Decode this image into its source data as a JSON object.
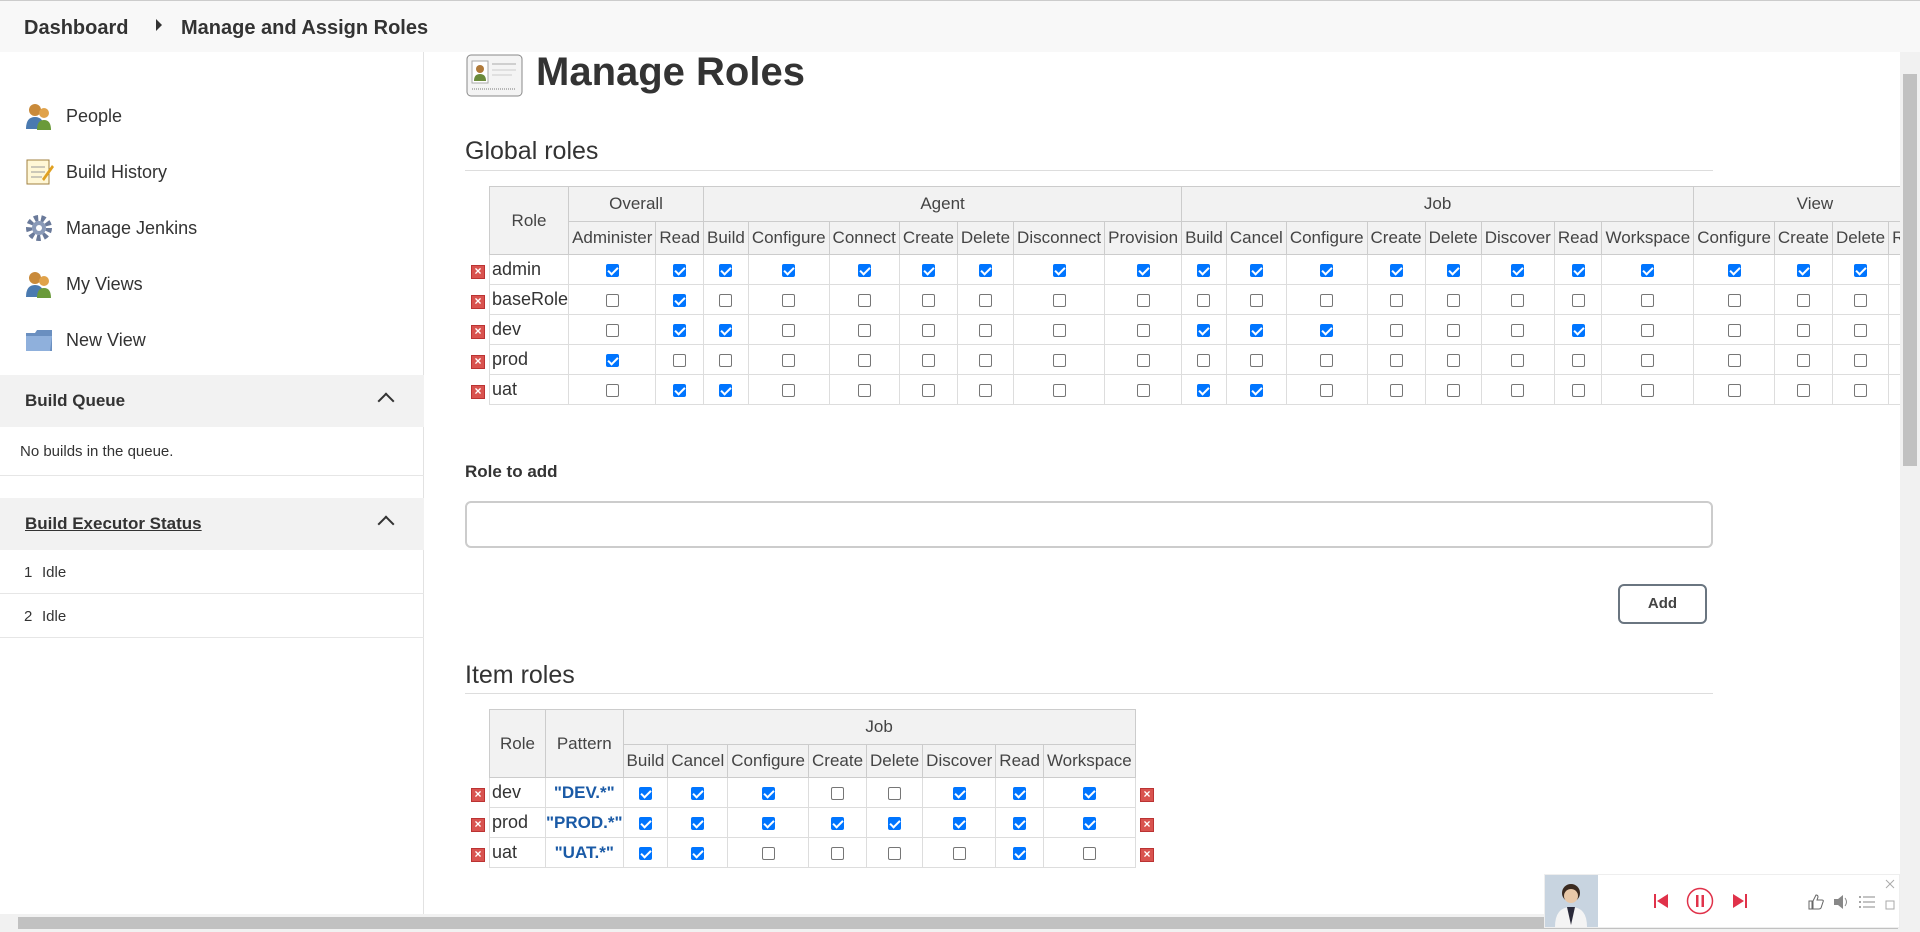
{
  "breadcrumb": {
    "dashboard": "Dashboard",
    "current": "Manage and Assign Roles"
  },
  "sidebar": {
    "items": [
      {
        "label": "People",
        "icon": "people-icon"
      },
      {
        "label": "Build History",
        "icon": "notepad-icon"
      },
      {
        "label": "Manage Jenkins",
        "icon": "gear-icon"
      },
      {
        "label": "My Views",
        "icon": "people-icon"
      },
      {
        "label": "New View",
        "icon": "folder-icon"
      }
    ]
  },
  "build_queue": {
    "title": "Build Queue",
    "empty": "No builds in the queue."
  },
  "executors": {
    "title": "Build Executor Status",
    "rows": [
      {
        "num": "1",
        "status": "Idle"
      },
      {
        "num": "2",
        "status": "Idle"
      }
    ]
  },
  "page_title": "Manage Roles",
  "global": {
    "title": "Global roles",
    "role_header": "Role",
    "groups": [
      {
        "name": "Overall",
        "perms": [
          "Administer",
          "Read"
        ]
      },
      {
        "name": "Agent",
        "perms": [
          "Build",
          "Configure",
          "Connect",
          "Create",
          "Delete",
          "Disconnect",
          "Provision"
        ]
      },
      {
        "name": "Job",
        "perms": [
          "Build",
          "Cancel",
          "Configure",
          "Create",
          "Delete",
          "Discover",
          "Read",
          "Workspace"
        ]
      },
      {
        "name": "View",
        "perms": [
          "Configure",
          "Create",
          "Delete",
          "Read"
        ]
      }
    ],
    "rows": [
      {
        "role": "admin",
        "checks": [
          1,
          1,
          1,
          1,
          1,
          1,
          1,
          1,
          1,
          1,
          1,
          1,
          1,
          1,
          1,
          1,
          1,
          1,
          1,
          1,
          1
        ]
      },
      {
        "role": "baseRole",
        "checks": [
          0,
          1,
          0,
          0,
          0,
          0,
          0,
          0,
          0,
          0,
          0,
          0,
          0,
          0,
          0,
          0,
          0,
          0,
          0,
          0,
          0
        ]
      },
      {
        "role": "dev",
        "checks": [
          0,
          1,
          1,
          0,
          0,
          0,
          0,
          0,
          0,
          1,
          1,
          1,
          0,
          0,
          0,
          1,
          0,
          0,
          0,
          0,
          0
        ]
      },
      {
        "role": "prod",
        "checks": [
          1,
          0,
          0,
          0,
          0,
          0,
          0,
          0,
          0,
          0,
          0,
          0,
          0,
          0,
          0,
          0,
          0,
          0,
          0,
          0,
          0
        ]
      },
      {
        "role": "uat",
        "checks": [
          0,
          1,
          1,
          0,
          0,
          0,
          0,
          0,
          0,
          1,
          1,
          0,
          0,
          0,
          0,
          0,
          0,
          0,
          0,
          0,
          0
        ]
      }
    ]
  },
  "role_to_add": {
    "label": "Role to add",
    "value": "",
    "button": "Add"
  },
  "item": {
    "title": "Item roles",
    "role_header": "Role",
    "pattern_header": "Pattern",
    "groups": [
      {
        "name": "Job",
        "perms": [
          "Build",
          "Cancel",
          "Configure",
          "Create",
          "Delete",
          "Discover",
          "Read",
          "Workspace"
        ]
      }
    ],
    "rows": [
      {
        "role": "dev",
        "pattern": "\"DEV.*\"",
        "checks": [
          1,
          1,
          1,
          0,
          0,
          1,
          1,
          1
        ]
      },
      {
        "role": "prod",
        "pattern": "\"PROD.*\"",
        "checks": [
          1,
          1,
          1,
          1,
          1,
          1,
          1,
          1
        ]
      },
      {
        "role": "uat",
        "pattern": "\"UAT.*\"",
        "checks": [
          1,
          1,
          0,
          0,
          0,
          0,
          1,
          0
        ]
      }
    ]
  },
  "colors": {
    "accent": "#0075ff",
    "delete": "#d9534f",
    "pattern": "#1a5aa6"
  }
}
